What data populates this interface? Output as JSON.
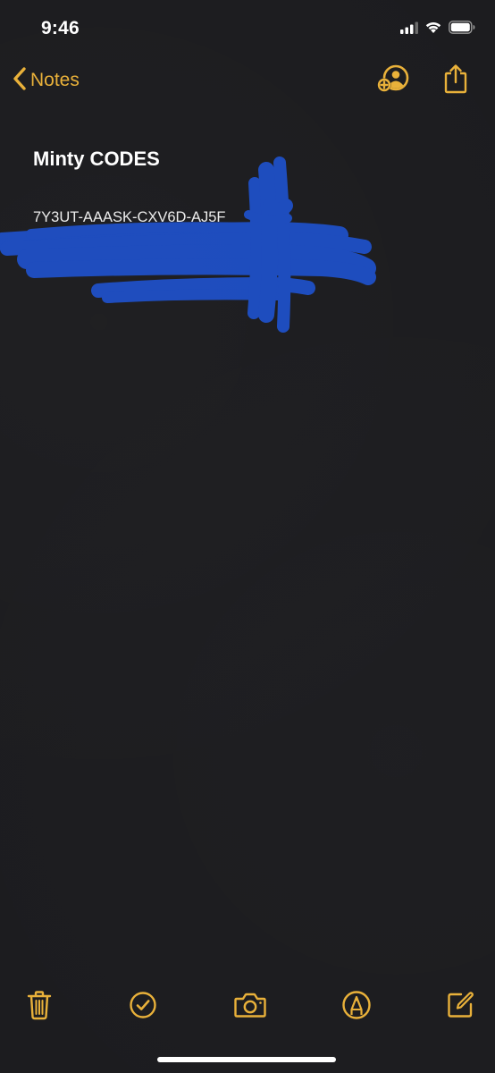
{
  "status_bar": {
    "time": "9:46",
    "icons": [
      "cellular-signal-icon",
      "wifi-icon",
      "battery-icon"
    ]
  },
  "nav_bar": {
    "back_label": "Notes",
    "back_icon": "chevron-left-icon",
    "actions": [
      "add-person-icon",
      "share-icon"
    ]
  },
  "note": {
    "title": "Minty CODES",
    "lines": [
      "7Y3UT-AAASK-CXV6D-AJ5F",
      "",
      ""
    ]
  },
  "toolbar": {
    "icons": [
      "trash-icon",
      "checklist-icon",
      "camera-icon",
      "markup-icon",
      "compose-icon"
    ]
  },
  "colors": {
    "accent": "#e9b13a",
    "background": "#1c1c1f",
    "text": "#ffffff",
    "redaction": "#1f4fc4"
  }
}
